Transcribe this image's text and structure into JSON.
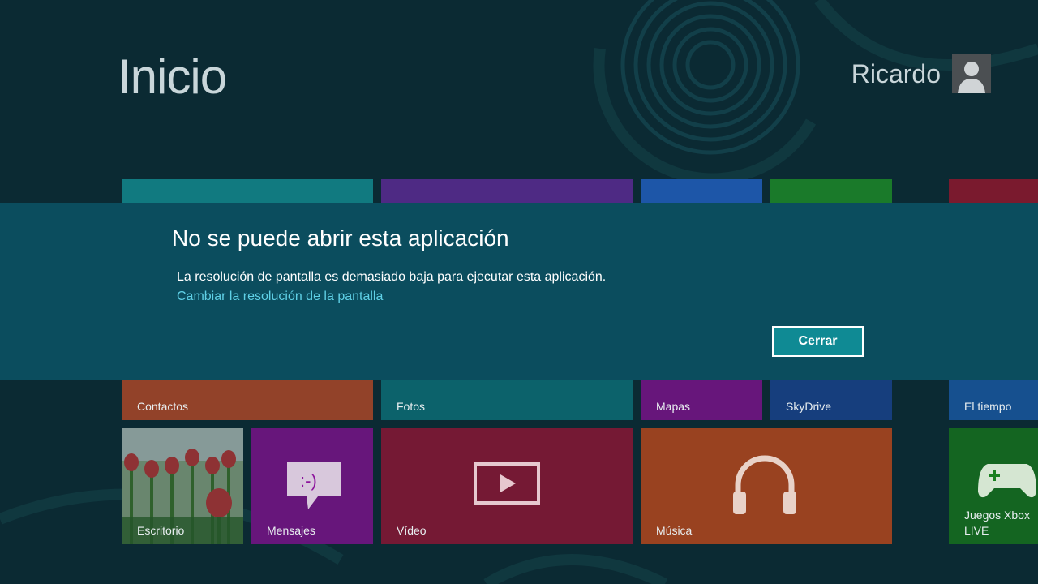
{
  "start": {
    "title": "Inicio",
    "user_name": "Ricardo"
  },
  "tiles": [
    {
      "label": "Contactos",
      "color": "#c8502a"
    },
    {
      "label": "Fotos",
      "color": "#0e7c86"
    },
    {
      "label": "Mapas",
      "color": "#8c139c"
    },
    {
      "label": "SkyDrive",
      "color": "#1d4a9e"
    },
    {
      "label": "El tiempo",
      "color": "#1d63b8"
    },
    {
      "label": "Escritorio",
      "color": "#5b8f3a"
    },
    {
      "label": "Mensajes",
      "color": "#8c139c"
    },
    {
      "label": "Vídeo",
      "color": "#a0173a"
    },
    {
      "label": "Música",
      "color": "#d2501e"
    },
    {
      "label": "Juegos Xbox LIVE",
      "color": "#19801f"
    }
  ],
  "dialog": {
    "title": "No se puede abrir esta aplicación",
    "message": "La resolución de pantalla es demasiado baja para ejecutar esta aplicación.",
    "link": "Cambiar la resolución de la pantalla",
    "close_button": "Cerrar"
  },
  "colors": {
    "background": "#0b2a33",
    "dialog_background": "#0b4d5e",
    "link": "#5fd0e6",
    "button": "#0f8a94"
  }
}
